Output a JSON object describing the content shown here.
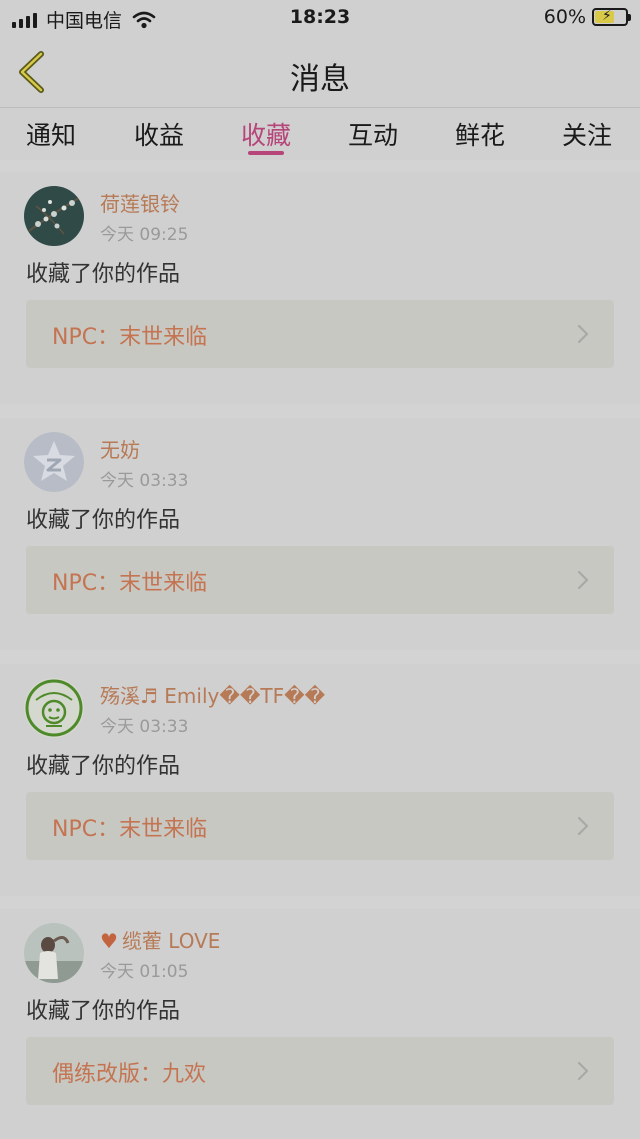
{
  "status_bar": {
    "carrier": "中国电信",
    "time": "18:23",
    "battery_percent": "60%",
    "battery_level": 0.6,
    "icons": [
      "signal-icon",
      "wifi-icon",
      "battery-charging-icon"
    ]
  },
  "nav": {
    "title": "消息",
    "back_icon": "chevron-left-icon"
  },
  "tabs": [
    {
      "label": "通知",
      "active": false
    },
    {
      "label": "收益",
      "active": false
    },
    {
      "label": "收藏",
      "active": true
    },
    {
      "label": "互动",
      "active": false
    },
    {
      "label": "鲜花",
      "active": false
    },
    {
      "label": "关注",
      "active": false
    }
  ],
  "colors": {
    "accent": "#b6457a",
    "username": "#b77a57",
    "work_title": "#c47451"
  },
  "messages": [
    {
      "user": "荷莲银铃",
      "time": "今天 09:25",
      "action": "收藏了你的作品",
      "work": "NPC：末世来临",
      "avatar": "flower-branch-avatar"
    },
    {
      "user": "无妨",
      "time": "今天 03:33",
      "action": "收藏了你的作品",
      "work": "NPC：末世来临",
      "avatar": "qzone-star-avatar"
    },
    {
      "user": "殇溪♬ Emily��TF��",
      "time": "今天 03:33",
      "action": "收藏了你的作品",
      "work": "NPC：末世来临",
      "avatar": "green-badge-avatar"
    },
    {
      "user": "缆蒮 LOVE",
      "user_prefix_icon": "heart-icon",
      "time": "今天 01:05",
      "action": "收藏了你的作品",
      "work": "偶练改版：九欢",
      "avatar": "photo-avatar"
    }
  ]
}
